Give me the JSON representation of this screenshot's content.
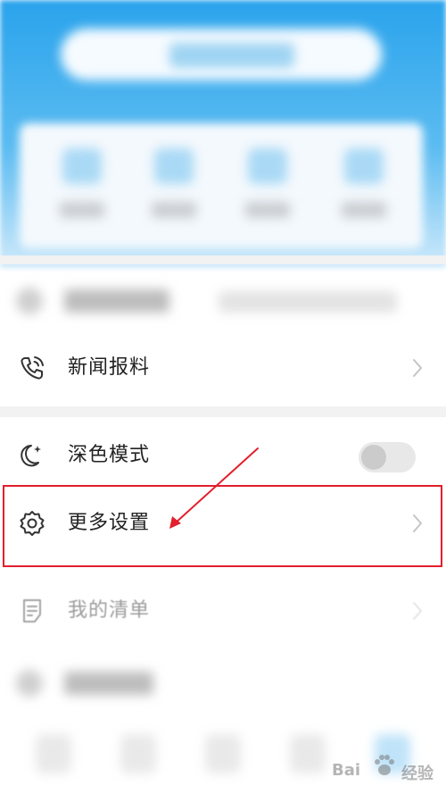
{
  "menu": {
    "items": [
      {
        "id": "news-tip",
        "label": "新闻报料",
        "icon": "phone-call-icon",
        "has_chevron": true
      },
      {
        "id": "dark-mode",
        "label": "深色模式",
        "icon": "moon-icon",
        "toggle_on": false
      },
      {
        "id": "more-settings",
        "label": "更多设置",
        "icon": "gear-icon",
        "has_chevron": true,
        "highlighted": true
      },
      {
        "id": "my-list",
        "label": "我的清单",
        "icon": "document-list-icon",
        "has_chevron": true,
        "dimmed": true
      }
    ]
  },
  "annotation": {
    "highlight_color": "#e21f2d"
  },
  "watermark": {
    "text_left": "Bai",
    "text_right": "经验"
  },
  "colors": {
    "hero_blue": "#2aa3ec",
    "text": "#222222",
    "toggle_off": "#e8e8e8"
  }
}
